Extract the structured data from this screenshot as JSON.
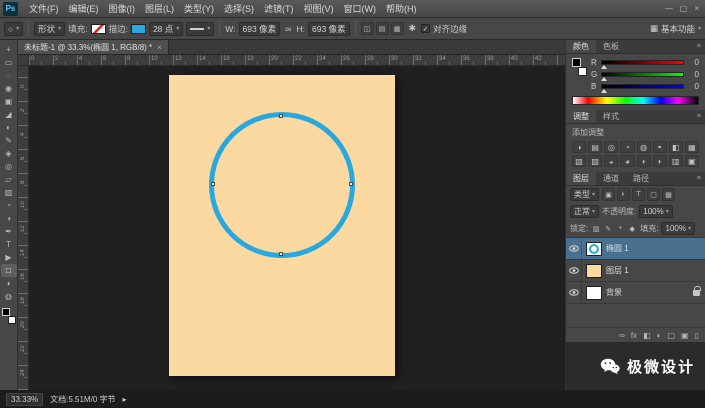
{
  "window": {
    "logo": "Ps",
    "controls": {
      "minimize": "—",
      "maximize": "▢",
      "close": "×"
    }
  },
  "menubar": {
    "items": [
      "文件(F)",
      "编辑(E)",
      "图像(I)",
      "图层(L)",
      "类型(Y)",
      "选择(S)",
      "滤镜(T)",
      "视图(V)",
      "窗口(W)",
      "帮助(H)"
    ]
  },
  "options": {
    "tool_preset_icon": "○",
    "mode": "形状",
    "fill_label": "填充:",
    "stroke_label": "描边:",
    "stroke_width": "28 点",
    "w_label": "W:",
    "w_value": "693 像素",
    "link_icon": "∞",
    "h_label": "H:",
    "h_value": "693 像素",
    "ops_icons": [
      {
        "name": "path-operations-icon",
        "glyph": "◫"
      },
      {
        "name": "path-alignment-icon",
        "glyph": "▤"
      },
      {
        "name": "path-arrange-icon",
        "glyph": "▦"
      }
    ],
    "gear_icon": "✱",
    "align_edges_check": "✓",
    "align_edges_label": "对齐边缘",
    "workspace_icon": "▦",
    "workspace": "基本功能",
    "caret": "▾"
  },
  "toolbar": {
    "tools": [
      {
        "name": "move-tool",
        "glyph": "+"
      },
      {
        "name": "marquee-tool",
        "glyph": "▭"
      },
      {
        "name": "lasso-tool",
        "glyph": "◌"
      },
      {
        "name": "quick-selection-tool",
        "glyph": "◉"
      },
      {
        "name": "crop-tool",
        "glyph": "▣"
      },
      {
        "name": "eyedropper-tool",
        "glyph": "◢"
      },
      {
        "name": "healing-brush-tool",
        "glyph": "◐"
      },
      {
        "name": "brush-tool",
        "glyph": "✎"
      },
      {
        "name": "clone-stamp-tool",
        "glyph": "◈"
      },
      {
        "name": "history-brush-tool",
        "glyph": "◎"
      },
      {
        "name": "eraser-tool",
        "glyph": "▱"
      },
      {
        "name": "gradient-tool",
        "glyph": "▨"
      },
      {
        "name": "blur-tool",
        "glyph": "◔"
      },
      {
        "name": "dodge-tool",
        "glyph": "◑"
      },
      {
        "name": "pen-tool",
        "glyph": "✒"
      },
      {
        "name": "type-tool",
        "glyph": "T"
      },
      {
        "name": "path-selection-tool",
        "glyph": "▶"
      },
      {
        "name": "ellipse-shape-tool",
        "glyph": "□"
      },
      {
        "name": "hand-tool",
        "glyph": "◖"
      },
      {
        "name": "zoom-tool",
        "glyph": "◍"
      }
    ]
  },
  "tabbar": {
    "title": "未标题-1 @ 33.3%(椭圆 1, RGB/8) *",
    "close": "×"
  },
  "rulers": {
    "horizontal": [
      "0",
      "2",
      "4",
      "6",
      "8",
      "10",
      "12",
      "14",
      "16",
      "18",
      "20",
      "22",
      "24",
      "26",
      "28",
      "30",
      "32",
      "34",
      "36",
      "38",
      "40",
      "42"
    ],
    "vertical": [
      "0",
      "2",
      "4",
      "6",
      "8",
      "10",
      "12",
      "14",
      "16",
      "18",
      "20",
      "22",
      "24"
    ]
  },
  "color_panel": {
    "tabs": [
      "颜色",
      "色板"
    ],
    "menu_icon": "≡",
    "channels": [
      {
        "label": "R",
        "value": "0"
      },
      {
        "label": "G",
        "value": "0"
      },
      {
        "label": "B",
        "value": "0"
      }
    ]
  },
  "adjustments_panel": {
    "tabs": [
      "调整",
      "样式"
    ],
    "menu_icon": "≡",
    "subtitle": "添加调整",
    "icons": [
      {
        "name": "brightness-contrast-icon",
        "glyph": "◑"
      },
      {
        "name": "levels-icon",
        "glyph": "▤"
      },
      {
        "name": "curves-icon",
        "glyph": "◎"
      },
      {
        "name": "exposure-icon",
        "glyph": "◔"
      },
      {
        "name": "vibrance-icon",
        "glyph": "◍"
      },
      {
        "name": "hue-saturation-icon",
        "glyph": "◓"
      },
      {
        "name": "color-balance-icon",
        "glyph": "◧"
      },
      {
        "name": "black-white-icon",
        "glyph": "▦"
      },
      {
        "name": "photo-filter-icon",
        "glyph": "▧"
      },
      {
        "name": "channel-mixer-icon",
        "glyph": "▨"
      },
      {
        "name": "color-lookup-icon",
        "glyph": "◒"
      },
      {
        "name": "invert-icon",
        "glyph": "◕"
      },
      {
        "name": "posterize-icon",
        "glyph": "◖"
      },
      {
        "name": "threshold-icon",
        "glyph": "◗"
      },
      {
        "name": "gradient-map-icon",
        "glyph": "▥"
      },
      {
        "name": "selective-color-icon",
        "glyph": "▣"
      }
    ]
  },
  "layers_panel": {
    "tabs": [
      "图层",
      "通道",
      "路径"
    ],
    "menu_icon": "≡",
    "filter_label": "类型",
    "filter_icons": [
      {
        "name": "pixel-filter-icon",
        "glyph": "▣"
      },
      {
        "name": "adjustment-filter-icon",
        "glyph": "◐"
      },
      {
        "name": "type-filter-icon",
        "glyph": "T"
      },
      {
        "name": "shape-filter-icon",
        "glyph": "▢"
      },
      {
        "name": "smart-object-filter-icon",
        "glyph": "▦"
      }
    ],
    "blend_mode": "正常",
    "opacity_label": "不透明度:",
    "opacity_value": "100%",
    "lock_label": "锁定:",
    "lock_icons": [
      {
        "name": "lock-transparent-icon",
        "glyph": "▨"
      },
      {
        "name": "lock-pixels-icon",
        "glyph": "✎"
      },
      {
        "name": "lock-position-icon",
        "glyph": "+"
      },
      {
        "name": "lock-all-icon",
        "glyph": "◆"
      }
    ],
    "fill_label": "填充:",
    "fill_value": "100%",
    "rows": [
      {
        "name": "椭圆 1",
        "selected": true
      },
      {
        "name": "图层 1",
        "selected": false
      },
      {
        "name": "背景",
        "selected": false,
        "locked": true
      }
    ],
    "footer_icons": [
      {
        "name": "link-layers-icon",
        "glyph": "∞"
      },
      {
        "name": "layer-style-icon",
        "glyph": "fx"
      },
      {
        "name": "layer-mask-icon",
        "glyph": "◧"
      },
      {
        "name": "adjustment-layer-icon",
        "glyph": "◐"
      },
      {
        "name": "layer-group-icon",
        "glyph": "▢"
      },
      {
        "name": "new-layer-icon",
        "glyph": "▣"
      },
      {
        "name": "delete-layer-icon",
        "glyph": "▯"
      }
    ]
  },
  "watermark": {
    "text": "极微设计"
  },
  "status": {
    "zoom": "33.33%",
    "doc_info": "文档:5.51M/0 字节",
    "arrow": "▸"
  },
  "colors": {
    "accent_blue": "#29a8e0",
    "document_bg": "#fbd9a0",
    "selected_layer_bg": "#49708f"
  }
}
